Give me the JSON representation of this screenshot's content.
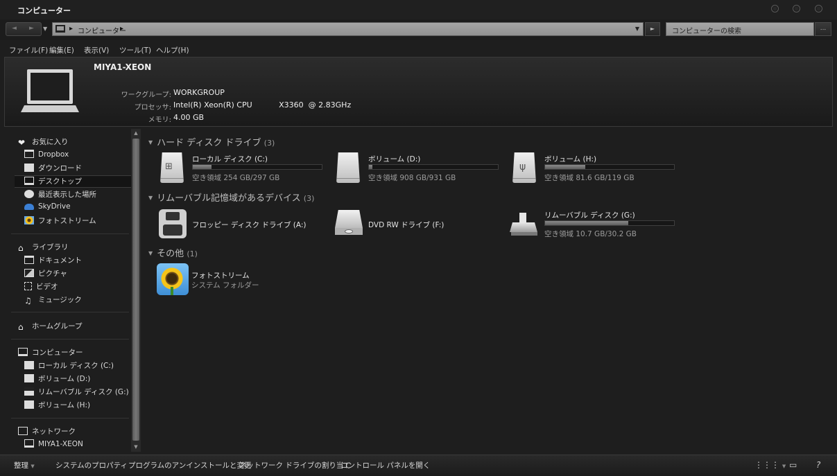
{
  "window": {
    "title": "コンピューター"
  },
  "address": {
    "segments": [
      "コンピューター"
    ],
    "search_placeholder": "コンピューターの検索",
    "more": "..."
  },
  "menu": [
    "ファイル(F)",
    "編集(E)",
    "表示(V)",
    "ツール(T)",
    "ヘルプ(H)"
  ],
  "details": {
    "name": "MIYA1-XEON",
    "workgroup_label": "ワークグループ:",
    "workgroup": "WORKGROUP",
    "processor_label": "プロセッサ:",
    "processor": "Intel(R) Xeon(R) CPU           X3360  @ 2.83GHz",
    "memory_label": "メモリ:",
    "memory": "4.00 GB"
  },
  "nav": {
    "favorites": "お気に入り",
    "favorites_items": [
      "Dropbox",
      "ダウンロード",
      "デスクトップ",
      "最近表示した場所",
      "SkyDrive",
      "フォトストリーム"
    ],
    "libraries": "ライブラリ",
    "library_items": [
      "ドキュメント",
      "ピクチャ",
      "ビデオ",
      "ミュージック"
    ],
    "homegroup": "ホームグループ",
    "computer": "コンピューター",
    "computer_items": [
      "ローカル ディスク (C:)",
      "ボリューム (D:)",
      "リムーバブル ディスク (G:)",
      "ボリューム (H:)"
    ],
    "network": "ネットワーク",
    "network_items": [
      "MIYA1-XEON"
    ]
  },
  "groups": {
    "hdd": {
      "title": "ハード ディスク ドライブ",
      "count": "(3)"
    },
    "removable": {
      "title": "リムーバブル記憶域があるデバイス",
      "count": "(3)"
    },
    "other": {
      "title": "その他",
      "count": "(1)"
    }
  },
  "drives": {
    "c": {
      "name": "ローカル ディスク (C:)",
      "free": "空き領域 254 GB/297 GB",
      "used_fraction": 0.145
    },
    "d": {
      "name": "ボリューム (D:)",
      "free": "空き領域 908 GB/931 GB",
      "used_fraction": 0.025
    },
    "h": {
      "name": "ボリューム (H:)",
      "free": "空き領域 81.6 GB/119 GB",
      "used_fraction": 0.31
    },
    "a": {
      "name": "フロッピー ディスク ドライブ (A:)"
    },
    "f": {
      "name": "DVD RW ドライブ (F:)"
    },
    "g": {
      "name": "リムーバブル ディスク (G:)",
      "free": "空き領域 10.7 GB/30.2 GB",
      "used_fraction": 0.645
    }
  },
  "other_item": {
    "name": "フォトストリーム",
    "sub": "システム フォルダー"
  },
  "commands": [
    "整理",
    "システムのプロパティ",
    "プログラムのアンインストールと変更",
    "ネットワーク ドライブの割り当て",
    "コントロール パネルを開く"
  ],
  "accent_colors": {
    "background": "#1e1e1e",
    "bar_fill": "#6e6e6e",
    "skydrive": "#3b7fd4"
  }
}
